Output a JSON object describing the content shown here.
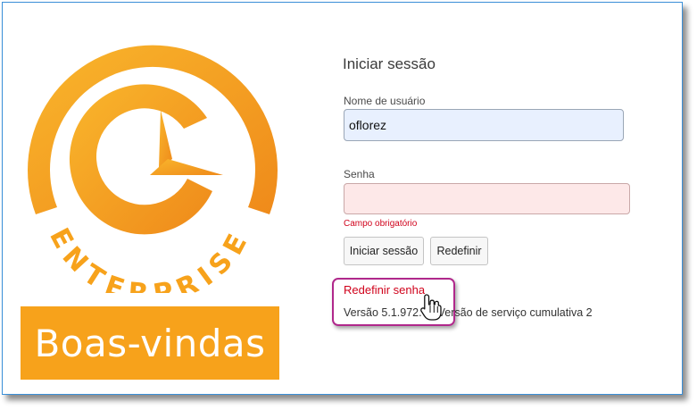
{
  "brand": {
    "logo_word": "ENTERPRISE",
    "welcome": "Boas-vindas",
    "accent": "#f7a21b",
    "accent_dark": "#ef8a1a"
  },
  "login": {
    "title": "Iniciar sessão",
    "username_label": "Nome de usuário",
    "username_value": "oflorez",
    "password_label": "Senha",
    "password_value": "",
    "required_error": "Campo obrigatório",
    "login_button": "Iniciar sessão",
    "reset_button": "Redefinir",
    "reset_password_link": "Redefinir senha",
    "version": "Versão 5.1.972.7 - Versão de serviço cumulativa 2"
  },
  "colors": {
    "frame_border": "#3a8fd8",
    "highlight_border": "#b0288b",
    "error": "#d0021b",
    "username_bg": "#e8f0fe",
    "password_bg": "#fde8e8"
  }
}
